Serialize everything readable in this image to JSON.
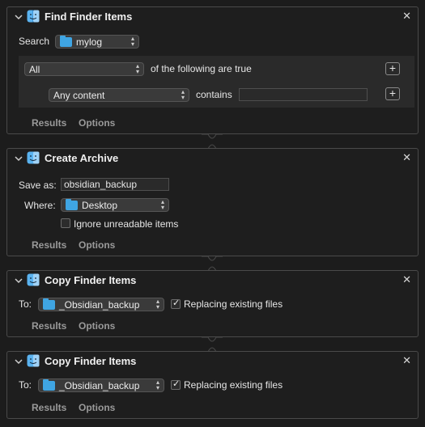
{
  "actions": [
    {
      "title": "Find Finder Items",
      "search_label": "Search",
      "search_value": "mylog",
      "all_value": "All",
      "of_following": "of the following are true",
      "condition_value": "Any content",
      "contains_label": "contains",
      "contains_value": "",
      "results": "Results",
      "options": "Options"
    },
    {
      "title": "Create Archive",
      "save_as_label": "Save as:",
      "save_as_value": "obsidian_backup",
      "where_label": "Where:",
      "where_value": "Desktop",
      "ignore_label": "Ignore unreadable items",
      "ignore_checked": false,
      "results": "Results",
      "options": "Options"
    },
    {
      "title": "Copy Finder Items",
      "to_label": "To:",
      "to_value": "_Obsidian_backup",
      "replace_label": "Replacing existing files",
      "replace_checked": true,
      "results": "Results",
      "options": "Options"
    },
    {
      "title": "Copy Finder Items",
      "to_label": "To:",
      "to_value": "_Obsidian_backup",
      "replace_label": "Replacing existing files",
      "replace_checked": true,
      "results": "Results",
      "options": "Options"
    }
  ],
  "icons": {
    "collapse": "chevron-down-icon",
    "app": "finder-icon",
    "close": "close-icon",
    "folder": "folder-icon",
    "add": "plus-icon"
  },
  "colors": {
    "folder": "#3fa5e3",
    "background": "#1c1c1c",
    "border": "#4a4a4a"
  }
}
